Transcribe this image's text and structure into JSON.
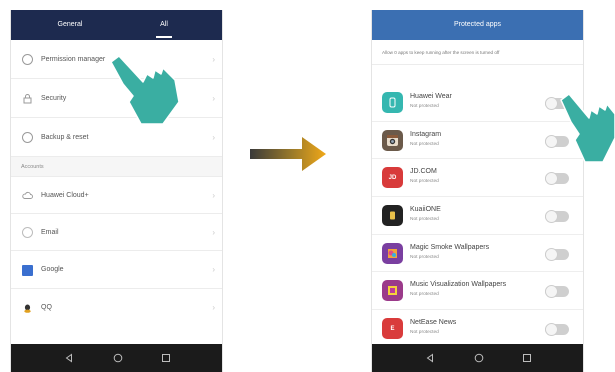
{
  "left_phone": {
    "tabs": [
      "General",
      "All"
    ],
    "menu_items": [
      {
        "label": "Permission manager",
        "icon": "permission-icon"
      },
      {
        "label": "Security",
        "icon": "lock-icon"
      },
      {
        "label": "Backup & reset",
        "icon": "backup-icon"
      }
    ],
    "accounts_header": "Accounts",
    "account_items": [
      {
        "label": "Huawei Cloud+",
        "icon": "cloud-icon"
      },
      {
        "label": "Email",
        "icon": "email-icon"
      },
      {
        "label": "Google",
        "icon": "google-icon"
      },
      {
        "label": "QQ",
        "icon": "qq-icon"
      }
    ],
    "chevron": "›"
  },
  "right_phone": {
    "title": "Protected apps",
    "hint": "Allow 0 apps to keep running after the screen is turned off",
    "apps": [
      {
        "name": "Huawei Wear",
        "status": "Not protected",
        "icon": "huawei-wear-icon",
        "color": "#35b7b0",
        "glyph": "",
        "enabled": false
      },
      {
        "name": "Instagram",
        "status": "Not protected",
        "icon": "instagram-icon",
        "color": "#6b5a4a",
        "glyph": "",
        "enabled": false
      },
      {
        "name": "JD.COM",
        "status": "Not protected",
        "icon": "jd-icon",
        "color": "#d83a3a",
        "glyph": "JD",
        "enabled": false
      },
      {
        "name": "KuaiiONE",
        "status": "Not protected",
        "icon": "kuaione-icon",
        "color": "#222222",
        "glyph": "",
        "enabled": false
      },
      {
        "name": "Magic Smoke Wallpapers",
        "status": "Not protected",
        "icon": "magic-smoke-icon",
        "color": "#7a3fa0",
        "glyph": "",
        "enabled": false
      },
      {
        "name": "Music Visualization Wallpapers",
        "status": "Not protected",
        "icon": "music-vis-icon",
        "color": "#9b3a8a",
        "glyph": "",
        "enabled": false
      },
      {
        "name": "NetEase News",
        "status": "Not protected",
        "icon": "netease-icon",
        "color": "#d93b3b",
        "glyph": "E",
        "enabled": false
      }
    ]
  },
  "nav": {
    "back_icon": "back-icon",
    "home_icon": "home-icon",
    "recents_icon": "recents-icon"
  },
  "colors": {
    "left_header": "#1d2a4f",
    "right_header": "#3b6fb2",
    "arrow": "#e0a020",
    "hand": "#3aaea2",
    "navbar": "#1b1b1b"
  }
}
